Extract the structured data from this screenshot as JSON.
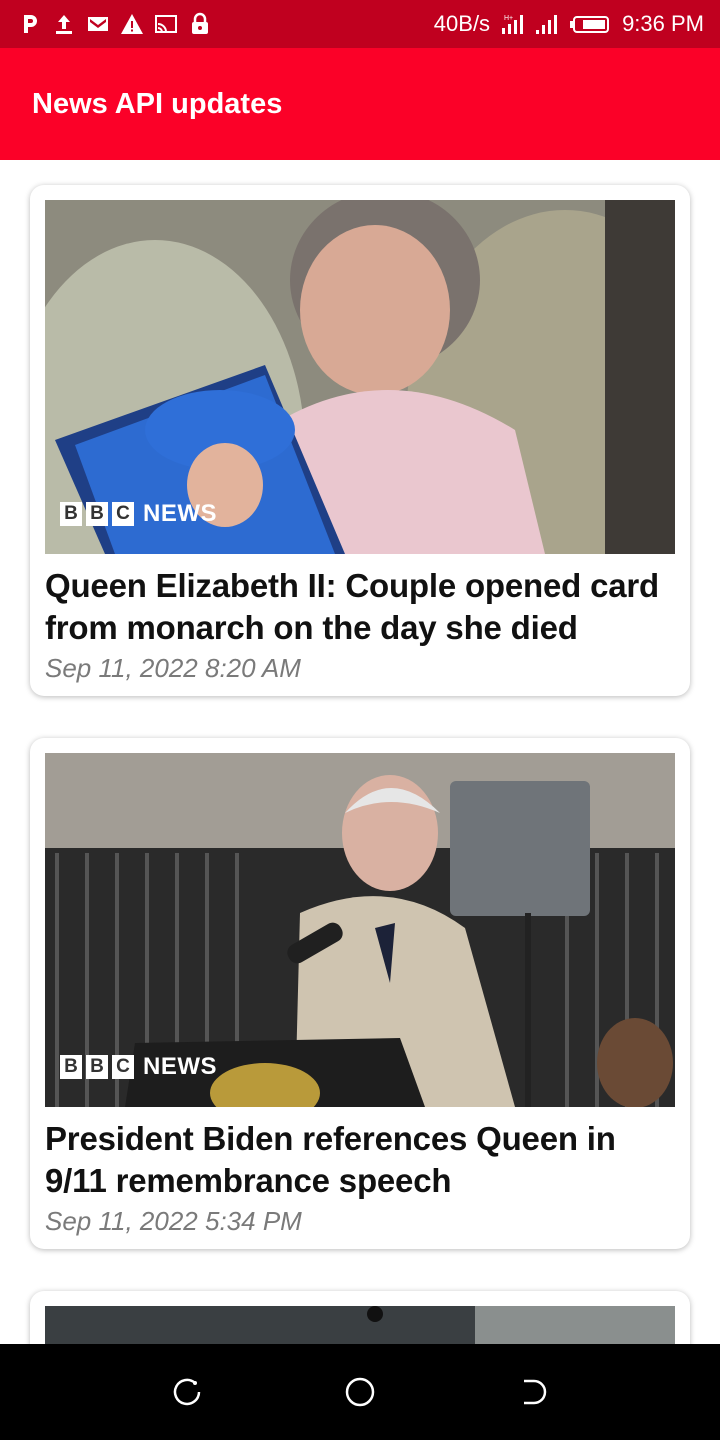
{
  "status_bar": {
    "left_icons": [
      "pinterest-icon",
      "upload-icon",
      "mail-icon",
      "warning-icon",
      "cast-icon",
      "lock-icon"
    ],
    "speed": "40B/s",
    "right_icons": [
      "signal-4g-icon",
      "signal-icon",
      "battery-icon"
    ],
    "time": "9:36 PM"
  },
  "app_bar": {
    "title": "News API updates"
  },
  "articles": [
    {
      "title": "Queen Elizabeth II: Couple opened card from monarch on the day she died",
      "date": "Sep 11, 2022 8:20 AM",
      "logo_letters": [
        "B",
        "B",
        "C"
      ],
      "logo_word": "NEWS"
    },
    {
      "title": "President Biden references Queen in 9/11 remembrance speech",
      "date": "Sep 11, 2022 5:34 PM",
      "logo_letters": [
        "B",
        "B",
        "C"
      ],
      "logo_word": "NEWS"
    }
  ],
  "nav_bar": {
    "buttons": [
      "recent-apps-icon",
      "home-icon",
      "back-icon"
    ]
  },
  "colors": {
    "status_bar": "#c0001f",
    "app_bar": "#fb0128"
  }
}
